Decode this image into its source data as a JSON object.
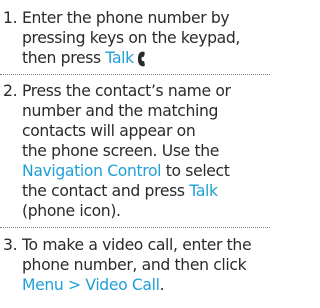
{
  "steps": [
    {
      "number": "1.",
      "line1": "Enter the phone number by",
      "line2": "pressing keys on the keypad,",
      "line3_pre": "then press ",
      "line3_kw": "Talk",
      "icon": "phone-handset-icon"
    },
    {
      "number": "2.",
      "line1": "Press the contact’s name or",
      "line2": "number and the matching",
      "line3": "contacts will appear on",
      "line4": "the phone screen. Use the",
      "line5_kw": "Navigation Control",
      "line5_post": " to select",
      "line6_pre": "the contact and press ",
      "line6_kw": "Talk",
      "line7": "(phone icon)."
    },
    {
      "number": "3.",
      "line1": "To make a video call, enter the",
      "line2": "phone number, and then click",
      "line3_kw": "Menu > Video Call",
      "line3_post": "."
    }
  ],
  "colors": {
    "text": "#2a2a2a",
    "keyword": "#1f9fd8",
    "separator": "#7f7f7f"
  }
}
